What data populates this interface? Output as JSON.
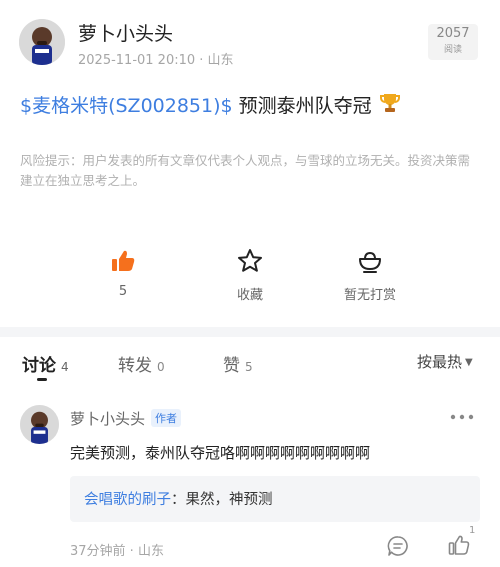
{
  "post": {
    "author": "萝卜小头头",
    "meta": "2025-11-01 20:10 · 山东",
    "read_count": "2057",
    "read_label": "阅读",
    "title_stock": "$麦格米特(SZ002851)$",
    "title_text": " 预测泰州队夺冠",
    "risk_tip": "风险提示：用户发表的所有文章仅代表个人观点，与雪球的立场无关。投资决策需建立在独立思考之上。"
  },
  "actions": {
    "like_count": "5",
    "favorite_label": "收藏",
    "reward_label": "暂无打赏"
  },
  "tabs": {
    "discuss_label": "讨论",
    "discuss_count": "4",
    "repost_label": "转发",
    "repost_count": "0",
    "like_label": "赞",
    "like_count": "5",
    "sort_label": "按最热"
  },
  "comment": {
    "author": "萝卜小头头",
    "author_tag": "作者",
    "text": "完美预测，泰州队夺冠咯啊啊啊啊啊啊啊啊啊",
    "reply_user": "会唱歌的刷子",
    "reply_text": "：果然，神预测",
    "meta": "37分钟前 · 山东",
    "like_count": "1"
  },
  "colors": {
    "accent_blue": "#3e7ee0",
    "like_orange": "#f5701d",
    "trophy_gold": "#f0a81c"
  },
  "icons": {
    "like": "thumbs-up-icon",
    "favorite": "star-icon",
    "reward": "bowl-icon",
    "trophy": "trophy-icon",
    "more": "more-dots-icon",
    "reply": "comment-icon"
  }
}
